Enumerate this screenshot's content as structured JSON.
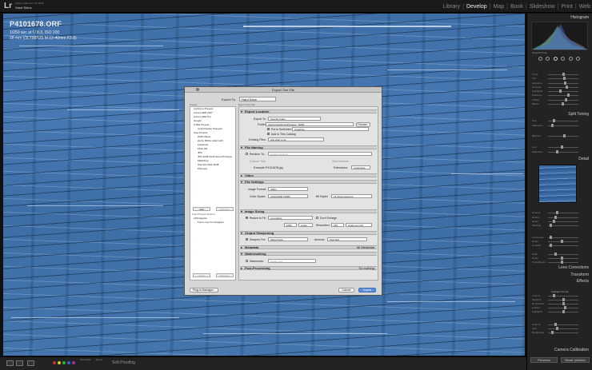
{
  "app": {
    "logo": "Lr",
    "edition": "Adobe Lightroom CC 2015",
    "user": "Xand Sirius"
  },
  "modules": [
    "Library",
    "Develop",
    "Map",
    "Book",
    "Slideshow",
    "Print",
    "Web"
  ],
  "active_module": "Develop",
  "photo_info": {
    "filename": "P4101678.ORF",
    "line1": "1/250 sec at f / 8.0, ISO 200",
    "line2": "28 mm (OLYMPUS M.12-40mm F2.8)"
  },
  "right_panel": {
    "histogram": "Histogram",
    "original_photo": "Original Photo",
    "basic": [
      "Temp",
      "Tint",
      "Exposure",
      "Contrast",
      "Highlights",
      "Shadows",
      "Whites",
      "Blacks"
    ],
    "split_toning": "Split Toning",
    "split_rows": [
      "Hue",
      "Saturation",
      "Balance",
      "Hue",
      "Saturation"
    ],
    "detail": "Detail",
    "detail_rows": [
      "Amount",
      "Radius",
      "Detail",
      "Masking",
      "Luminance",
      "Detail",
      "Contrast",
      "Color",
      "Detail",
      "Smoothness"
    ],
    "lens": "Lens Corrections",
    "transform": "Transform",
    "effects": "Effects",
    "vignette_style": "Highlight Priority",
    "effects_rows": [
      "Amount",
      "Midpoint",
      "Roundness",
      "Feather",
      "Highlights",
      "Amount",
      "Size",
      "Roughness"
    ],
    "camera": "Camera Calibration",
    "previous": "Previous",
    "reset": "Reset (Adobe)"
  },
  "bottom": {
    "soft_proofing": "Soft Proofing",
    "show_edit": "Show Edit",
    "reset": "Reset"
  },
  "dialog": {
    "title": "Export One File",
    "export_to_label": "Export To:",
    "export_to_value": "Hard Drive",
    "preset_label": "Preset:",
    "presets": [
      {
        "label": "Lightroom Presets",
        "sub": false
      },
      {
        "label": "Aurora HDR 2017",
        "sub": false
      },
      {
        "label": "Aurora HDR Pro",
        "sub": false
      },
      {
        "label": "Google",
        "sub": false
      },
      {
        "label": "X-Rite Presets",
        "sub": false
      },
      {
        "label": "ColorChecker Passport",
        "sub": true
      },
      {
        "label": "User Presets",
        "sub": false
      },
      {
        "label": "2048 offsets",
        "sub": true
      },
      {
        "label": "plenty 900px watermark",
        "sub": true
      },
      {
        "label": "Facebook",
        "sub": true
      },
      {
        "label": "Flickr HD",
        "sub": true
      },
      {
        "label": "JPG",
        "sub": true
      },
      {
        "label": "JPG 2048 Xand Sirius Photogra",
        "sub": true
      },
      {
        "label": "Mailchimp",
        "sub": true
      },
      {
        "label": "Olympus Web 2048",
        "sub": true
      },
      {
        "label": "Pinterest",
        "sub": true
      }
    ],
    "add": "Add",
    "remove": "Remove",
    "post_process": "Post-Process Actions:",
    "actions": [
      "LRInstagram",
      "Force crop for Instagram"
    ],
    "insert": "Insert",
    "remove2": "Remove",
    "plugin_manager": "Plug-in Manager...",
    "cancel": "Cancel",
    "export": "Export",
    "section_header": "Export One File",
    "sections": {
      "location": "Export Location",
      "naming": "File Naming",
      "video": "Video",
      "settings": "File Settings",
      "sizing": "Image Sizing",
      "sharpening": "Output Sharpening",
      "metadata": "Metadata",
      "metadata_value": "All Metadata",
      "watermark": "Watermarking",
      "post": "Post-Processing",
      "post_value": "Do nothing"
    },
    "location": {
      "export_to_label": "Export To:",
      "export_to_value": "Specific folder",
      "folder_label": "Folder:",
      "folder_path": "/Users/xandsirius/Pictures/_TEMP",
      "choose": "Choose...",
      "subfolder_label": "Put in Subfolder:",
      "subfolder_value": "instadrive",
      "add_catalog": "Add to This Catalog",
      "existing_label": "Existing Files:",
      "existing_value": "Ask what to do"
    },
    "naming": {
      "rename_label": "Rename To:",
      "rename_value": "Custom Settings",
      "custom_text": "Custom Text:",
      "start_number": "Start Number:",
      "example_label": "Example:",
      "example_value": "P4101678.jpg",
      "ext_label": "Extensions:",
      "ext_value": "Lowercase"
    },
    "settings": {
      "format_label": "Image Format:",
      "format_value": "JPEG",
      "colorspace_label": "Color Space:",
      "colorspace_value": "AdobeRGB (1998)",
      "bitdepth_label": "Bit Depth:",
      "bitdepth_value": "16 bits/component"
    },
    "sizing": {
      "resize_label": "Resize to Fit:",
      "resize_value": "Long Edge",
      "enlarge": "Don't Enlarge",
      "size_value": "1080",
      "size_unit": "pixels",
      "resolution_label": "Resolution:",
      "resolution_value": "240",
      "resolution_unit": "pixels per inch"
    },
    "sharpening": {
      "sharpen_label": "Sharpen For:",
      "sharpen_value": "Matte Paper",
      "amount_label": "Amount:",
      "amount_value": "Standard"
    },
    "watermark": {
      "label": "Watermark:",
      "value": "simple_text"
    }
  }
}
